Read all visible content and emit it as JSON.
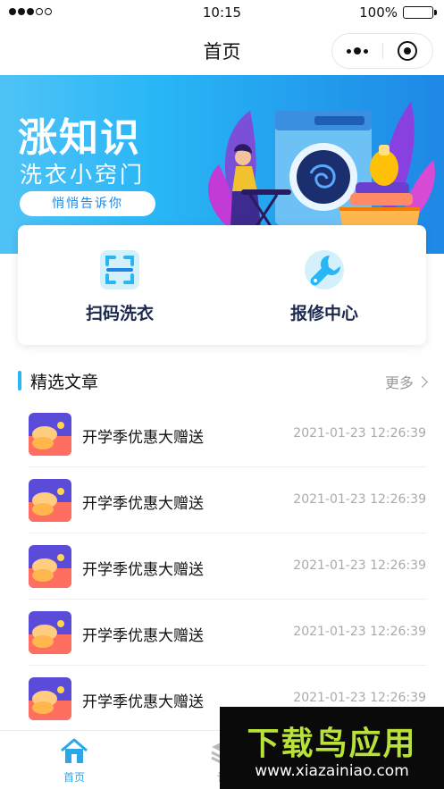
{
  "status_bar": {
    "time": "10:15",
    "battery": "100%"
  },
  "nav": {
    "title": "首页"
  },
  "banner": {
    "title": "涨知识",
    "subtitle": "洗衣小窍门",
    "pill": "悄悄告诉你"
  },
  "shortcuts": [
    {
      "label": "扫码洗衣",
      "icon": "scan-icon"
    },
    {
      "label": "报修中心",
      "icon": "wrench-icon"
    }
  ],
  "section": {
    "title": "精选文章",
    "more": "更多"
  },
  "articles": [
    {
      "title": "开学季优惠大赠送",
      "date": "2021-01-23 12:26:39"
    },
    {
      "title": "开学季优惠大赠送",
      "date": "2021-01-23 12:26:39"
    },
    {
      "title": "开学季优惠大赠送",
      "date": "2021-01-23 12:26:39"
    },
    {
      "title": "开学季优惠大赠送",
      "date": "2021-01-23 12:26:39"
    },
    {
      "title": "开学季优惠大赠送",
      "date": "2021-01-23 12:26:39"
    }
  ],
  "tabs": [
    {
      "label": "首页",
      "icon": "home-icon",
      "active": true
    },
    {
      "label": "订",
      "icon": "order-icon",
      "active": false
    }
  ],
  "watermark": {
    "title": "下载鸟应用",
    "url": "www.xiazainiao.com"
  },
  "colors": {
    "accent": "#29b6f6",
    "banner_end": "#1e88e5",
    "text_dark": "#1b2a4e"
  }
}
